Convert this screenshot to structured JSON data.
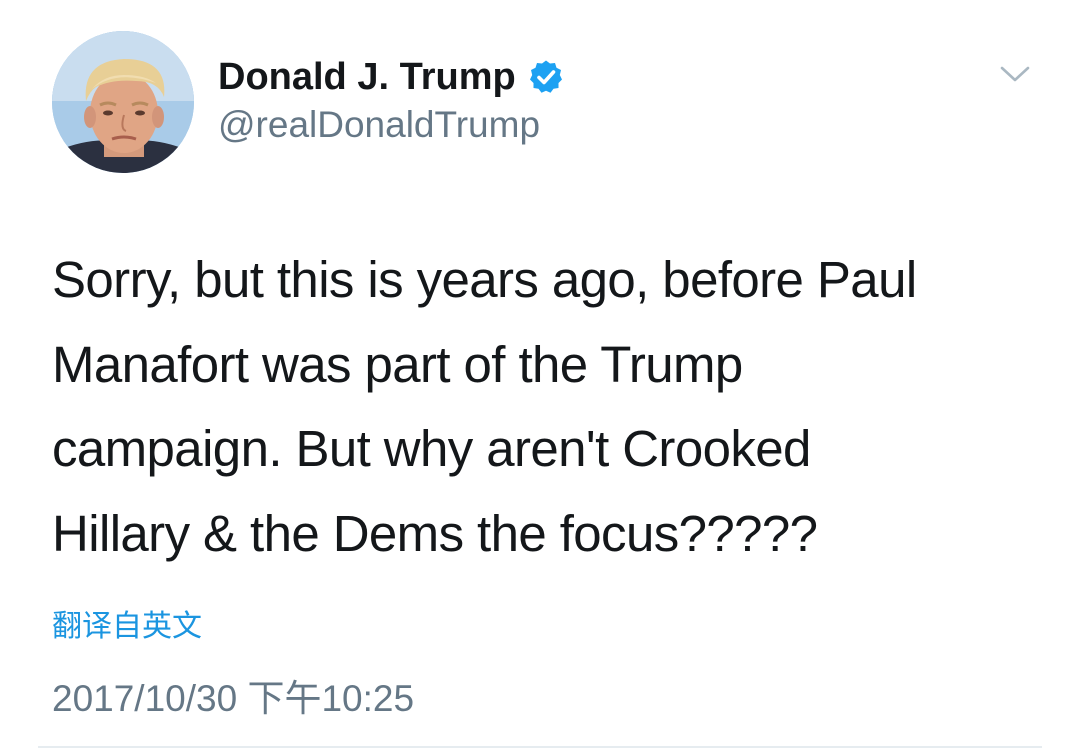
{
  "author": {
    "display_name": "Donald J. Trump",
    "handle": "@realDonaldTrump",
    "verified": true
  },
  "tweet": {
    "lines": [
      "Sorry, but this is years ago, before Paul",
      "Manafort was part of the Trump",
      "campaign. But why aren't Crooked",
      "Hillary & the Dems the focus?????"
    ],
    "translate_label": "翻译自英文",
    "timestamp": "2017/10/30 下午10:25"
  },
  "icons": {
    "verified": "verified-badge-icon",
    "menu": "chevron-down-icon"
  },
  "colors": {
    "text": "#14171a",
    "secondary": "#657786",
    "link": "#1b95e0",
    "verified": "#1da1f2"
  }
}
